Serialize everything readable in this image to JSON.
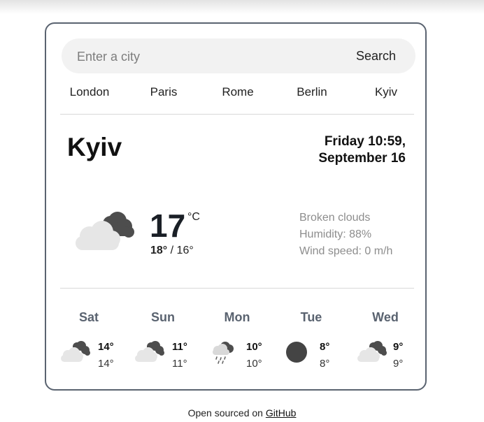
{
  "search": {
    "placeholder": "Enter a city",
    "button_label": "Search"
  },
  "cities": [
    "London",
    "Paris",
    "Rome",
    "Berlin",
    "Kyiv"
  ],
  "current": {
    "city": "Kyiv",
    "date_line1": "Friday 10:59,",
    "date_line2": "September 16",
    "temperature": "17",
    "unit": "°C",
    "max": "18°",
    "min": "16°",
    "description": "Broken clouds",
    "humidity": "Humidity: 88%",
    "wind": "Wind speed: 0 m/h",
    "icon": "broken-clouds-icon"
  },
  "forecast": [
    {
      "day": "Sat",
      "max": "14°",
      "min": "14°",
      "icon": "broken-clouds-icon"
    },
    {
      "day": "Sun",
      "max": "11°",
      "min": "11°",
      "icon": "broken-clouds-icon"
    },
    {
      "day": "Mon",
      "max": "10°",
      "min": "10°",
      "icon": "rain-icon"
    },
    {
      "day": "Tue",
      "max": "8°",
      "min": "8°",
      "icon": "clear-sky-icon"
    },
    {
      "day": "Wed",
      "max": "9°",
      "min": "9°",
      "icon": "broken-clouds-icon"
    }
  ],
  "footer": {
    "text": "Open sourced on",
    "link_label": "GitHub"
  }
}
